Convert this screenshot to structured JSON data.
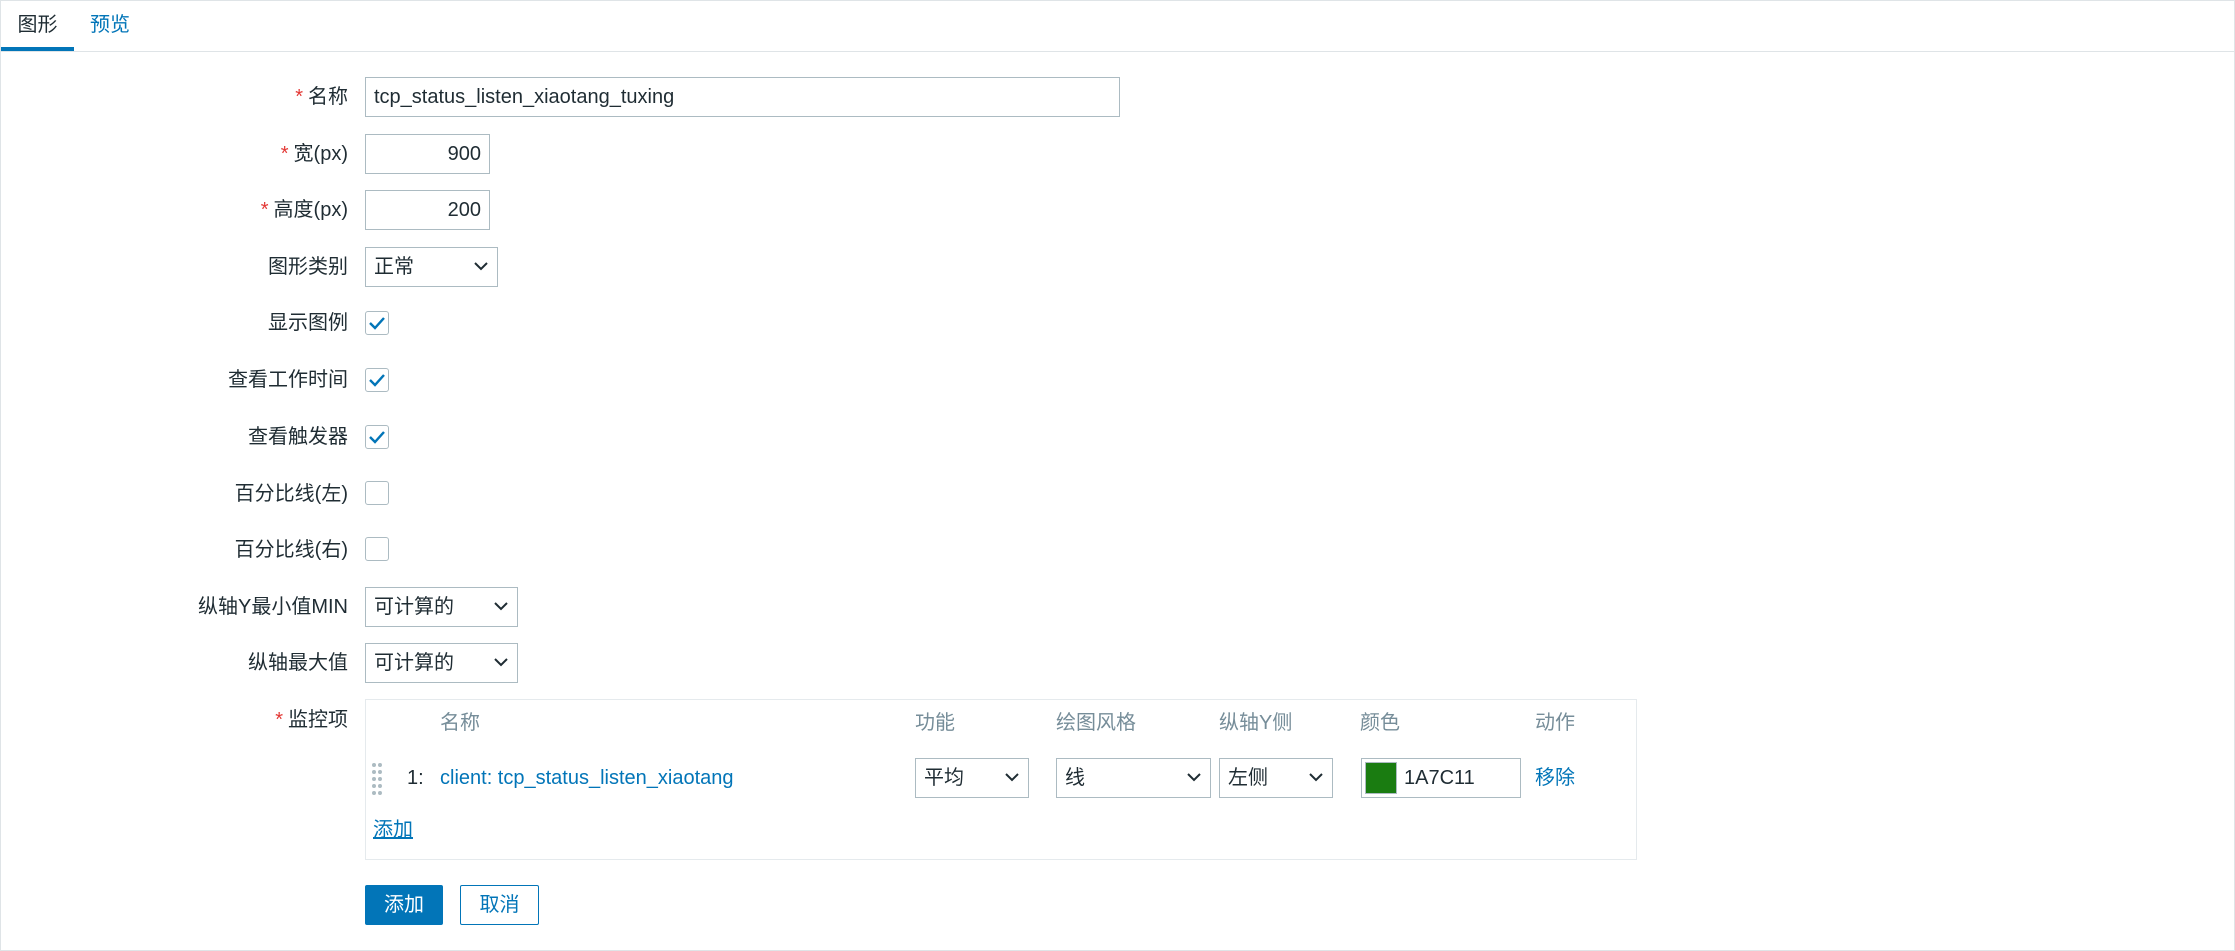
{
  "tabs": [
    {
      "label": "图形",
      "active": true
    },
    {
      "label": "预览",
      "active": false
    }
  ],
  "form": {
    "name": {
      "label": "名称",
      "required": true,
      "value": "tcp_status_listen_xiaotang_tuxing"
    },
    "width": {
      "label": "宽(px)",
      "required": true,
      "value": "900"
    },
    "height": {
      "label": "高度(px)",
      "required": true,
      "value": "200"
    },
    "graph_type": {
      "label": "图形类别",
      "value": "正常"
    },
    "show_legend": {
      "label": "显示图例",
      "checked": true
    },
    "show_working_time": {
      "label": "查看工作时间",
      "checked": true
    },
    "show_triggers": {
      "label": "查看触发器",
      "checked": true
    },
    "percentile_left": {
      "label": "百分比线(左)",
      "checked": false
    },
    "percentile_right": {
      "label": "百分比线(右)",
      "checked": false
    },
    "ymin_type": {
      "label": "纵轴Y最小值MIN",
      "value": "可计算的"
    },
    "ymax_type": {
      "label": "纵轴最大值",
      "value": "可计算的"
    },
    "items_label": {
      "label": "监控项",
      "required": true
    }
  },
  "items_table": {
    "headers": {
      "name": "名称",
      "function": "功能",
      "draw_style": "绘图风格",
      "y_axis_side": "纵轴Y侧",
      "color": "颜色",
      "action": "动作"
    },
    "rows": [
      {
        "index": "1:",
        "name": "client: tcp_status_listen_xiaotang",
        "function": "平均",
        "draw_style": "线",
        "y_axis_side": "左侧",
        "color": "1A7C11",
        "color_hex": "#1A7C11",
        "action": "移除"
      }
    ],
    "add_link": "添加"
  },
  "buttons": {
    "add": "添加",
    "cancel": "取消"
  },
  "colors": {
    "accent": "#0275b8",
    "required": "#e33734",
    "header_text": "#768d99"
  }
}
